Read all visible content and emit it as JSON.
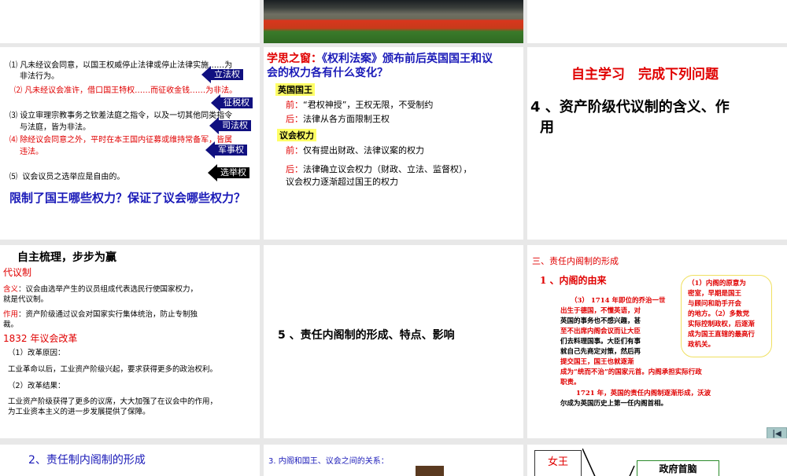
{
  "slides": {
    "s1": {
      "items": [
        {
          "num": "⑴",
          "text": "凡未经议会同意，以国王权威停止法律或停止法律实施……为",
          "text2": "非法行为。",
          "tag": "立法权"
        },
        {
          "num": "⑵",
          "text": "凡未经议会准许，借口国王特权……而征收金钱……为非法。",
          "tag": "征税权"
        },
        {
          "num": "⑶",
          "text": "设立审理宗教事务之钦差法庭之指令，以及一切其他同类指令",
          "text2": "与法庭，皆为非法。",
          "tag": "司法权"
        },
        {
          "num": "⑷",
          "text": "除经议会同意之外，平时在本王国内征募或维持常备军，皆属",
          "text2": "违法。",
          "tag": "军事权"
        },
        {
          "num": "⑸",
          "text": "议会议员之选举应是自由的。",
          "tag": "选举权"
        }
      ],
      "question": "限制了国王哪些权力？保证了议会哪些权力？"
    },
    "s2": {
      "title_red": "学思之窗：",
      "title_blue": "《权利法案》颁布前后英国国王和议",
      "title_blue2": "会的权力各有什么变化？",
      "king": "英国国王",
      "before": "前：",
      "after": "后：",
      "king_before": "“君权神授”，王权无限，不受制约",
      "king_after": "法律从各方面限制王权",
      "parl": "议会权力",
      "parl_before": "仅有提出财政、法律议案的权力",
      "parl_after": "法律确立议会权力（财政、立法、监督权），",
      "parl_after2": "议会权力逐渐超过国王的权力"
    },
    "s3": {
      "heading": "自主学习　完成下列问题",
      "q": "4 、资产阶级代议制的含义、作",
      "q2": "用"
    },
    "s4": {
      "title": "自主梳理，步步为赢",
      "sec1": "代议制",
      "l1": "含义",
      "t1": "：议会由选举产生的议员组成代表选民行使国家权力，",
      "t1b": "就是代议制。",
      "l2": "作用",
      "t2": "：资产阶级通过议会对国家实行集体统治，防止专制独",
      "t2b": "裁。",
      "sec2": "1832 年议会改革",
      "r1": "（1）改革原因：",
      "r1t": "工业革命以后，工业资产阶级兴起，要求获得更多的政治权利。",
      "r2": "（2）改革结果：",
      "r2t": "工业资产阶级获得了更多的议席，大大加强了在议会中的作用，",
      "r2t2": "为工业资本主义的进一步发展提供了保障。"
    },
    "s5": {
      "title": "5 、责任内阁制的形成、特点、影响"
    },
    "s6": {
      "heading": "三、责任内阁制的形成",
      "sub": "1 、内阁的由来",
      "p1": "（3） 1714 年即位的乔治一世",
      "p2": "出生于德国，不懂英语，对",
      "p3": "英国的事务也不感兴趣，甚",
      "p4": "至不出席内阁会议而让大臣",
      "p5": "们去料理国事。大臣们有事",
      "p6": "就自己先商定对策，然后再",
      "p7": "提交国王，国王也就逐渐",
      "p8": "成为“统而不治”的国家元首。内阁承担实际行政",
      "p9": "职责。",
      "p10": "1721 年，英国的责任内阁制逐渐形成，沃波",
      "p11": "尔成为英国历史上第一任内阁首相。",
      "box": [
        "（1）内阁的原意为",
        "密室，早期是国王",
        "与顾问和助手开会",
        "的地方。（2）多数党",
        "实际控制政权，后逐渐",
        "成为国王直辖的最高行",
        "政机关。"
      ]
    },
    "s7": {
      "title": "2、责任制内阁制的形成"
    },
    "s8": {
      "title": "3. 内阁和国王、议会之间的关系："
    },
    "s9": {
      "queen": "女王",
      "head": "政府首脑"
    }
  },
  "colors": {
    "bg": "#e8e8e8",
    "red": "#e00000",
    "blue": "#1a1ab8",
    "tag": "#101080"
  }
}
